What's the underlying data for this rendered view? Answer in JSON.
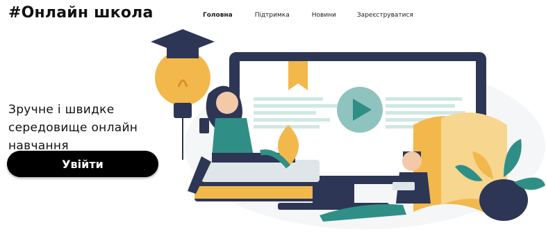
{
  "header": {
    "logo": "#Онлайн школа",
    "nav": [
      {
        "label": "Головна",
        "active": true
      },
      {
        "label": "Підтримка",
        "active": false
      },
      {
        "label": "Новини",
        "active": false
      },
      {
        "label": "Зареєструватися",
        "active": false
      }
    ]
  },
  "hero": {
    "lines": [
      "Зручне і швидке",
      "середовище онлайн",
      "навчання"
    ],
    "button_label": "Увійти"
  },
  "colors": {
    "accent_yellow": "#f2b84b",
    "navy": "#2e3656",
    "teal": "#2f8f86",
    "screen_teal": "#cfe8e2",
    "button": "#000000"
  }
}
